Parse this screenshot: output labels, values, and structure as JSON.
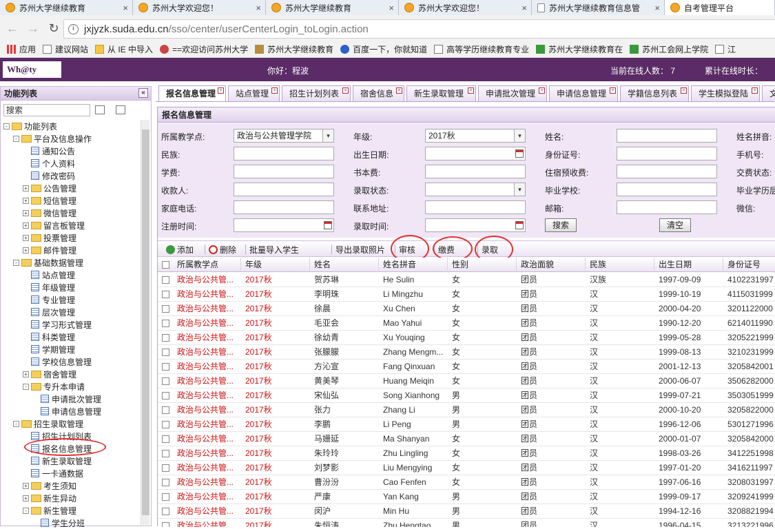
{
  "browser": {
    "tabs": [
      {
        "label": "苏州大学继续教育",
        "icon": "suda",
        "active": false
      },
      {
        "label": "苏州大学欢迎您！",
        "icon": "suda",
        "active": false
      },
      {
        "label": "苏州大学继续教育",
        "icon": "suda",
        "active": false
      },
      {
        "label": "苏州大学欢迎您！",
        "icon": "suda",
        "active": false
      },
      {
        "label": "苏州大学继续教育信息管",
        "icon": "page",
        "active": false
      },
      {
        "label": "自考管理平台",
        "icon": "suda",
        "active": true
      }
    ],
    "url_host": "jxjyzk.suda.edu.cn",
    "url_path": "/sso/center/userCenterLogin_toLogin.action",
    "bookmarks": [
      {
        "label": "应用",
        "icon": "apps"
      },
      {
        "label": "建议网站",
        "icon": "doc"
      },
      {
        "label": "从 IE 中导入",
        "icon": "folder"
      },
      {
        "label": "==欢迎访问苏州大学",
        "icon": "red"
      },
      {
        "label": "苏州大学继续教育",
        "icon": "suda"
      },
      {
        "label": "百度一下，你就知道",
        "icon": "blue"
      },
      {
        "label": "高等学历继续教育专业",
        "icon": "doc"
      },
      {
        "label": "苏州大学继续教育在",
        "icon": "green"
      },
      {
        "label": "苏州工会网上学院",
        "icon": "green"
      },
      {
        "label": "江",
        "icon": "doc"
      }
    ]
  },
  "header": {
    "logo": "Wh@ty",
    "greeting": "你好：程波",
    "online_now": "当前在线人数：  7",
    "online_total": "累计在线时长："
  },
  "left": {
    "title": "功能列表",
    "search": "搜索",
    "tree": [
      {
        "label": "功能列表",
        "level": 0,
        "kind": "folder",
        "pm": "-"
      },
      {
        "label": "平台及信息操作",
        "level": 1,
        "kind": "folder",
        "pm": "-"
      },
      {
        "label": "通知公告",
        "level": 2,
        "kind": "leaf"
      },
      {
        "label": "个人资料",
        "level": 2,
        "kind": "leaf"
      },
      {
        "label": "修改密码",
        "level": 2,
        "kind": "leaf"
      },
      {
        "label": "公告管理",
        "level": 2,
        "kind": "folder",
        "pm": "+"
      },
      {
        "label": "短信管理",
        "level": 2,
        "kind": "folder",
        "pm": "+"
      },
      {
        "label": "微信管理",
        "level": 2,
        "kind": "folder",
        "pm": "+"
      },
      {
        "label": "留言板管理",
        "level": 2,
        "kind": "folder",
        "pm": "+"
      },
      {
        "label": "投票管理",
        "level": 2,
        "kind": "folder",
        "pm": "+"
      },
      {
        "label": "邮件管理",
        "level": 2,
        "kind": "folder",
        "pm": "+"
      },
      {
        "label": "基础数据管理",
        "level": 1,
        "kind": "folder",
        "pm": "-"
      },
      {
        "label": "站点管理",
        "level": 2,
        "kind": "leaf"
      },
      {
        "label": "年级管理",
        "level": 2,
        "kind": "leaf"
      },
      {
        "label": "专业管理",
        "level": 2,
        "kind": "leaf"
      },
      {
        "label": "层次管理",
        "level": 2,
        "kind": "leaf"
      },
      {
        "label": "学习形式管理",
        "level": 2,
        "kind": "leaf"
      },
      {
        "label": "科类管理",
        "level": 2,
        "kind": "leaf"
      },
      {
        "label": "学期管理",
        "level": 2,
        "kind": "leaf"
      },
      {
        "label": "学校信息管理",
        "level": 2,
        "kind": "leaf"
      },
      {
        "label": "宿舍管理",
        "level": 2,
        "kind": "folder",
        "pm": "+"
      },
      {
        "label": "专升本申请",
        "level": 2,
        "kind": "folder",
        "pm": "-"
      },
      {
        "label": "申请批次管理",
        "level": 3,
        "kind": "leaf"
      },
      {
        "label": "申请信息管理",
        "level": 3,
        "kind": "leaf"
      },
      {
        "label": "招生录取管理",
        "level": 1,
        "kind": "folder",
        "pm": "-"
      },
      {
        "label": "招生计划列表",
        "level": 2,
        "kind": "leaf"
      },
      {
        "label": "报名信息管理",
        "level": 2,
        "kind": "leaf"
      },
      {
        "label": "新生录取管理",
        "level": 2,
        "kind": "leaf"
      },
      {
        "label": "一卡通数据",
        "level": 2,
        "kind": "leaf"
      },
      {
        "label": "考生须知",
        "level": 2,
        "kind": "folder",
        "pm": "+"
      },
      {
        "label": "新生异动",
        "level": 2,
        "kind": "folder",
        "pm": "+"
      },
      {
        "label": "新生管理",
        "level": 2,
        "kind": "folder",
        "pm": "-"
      },
      {
        "label": "学生分班",
        "level": 3,
        "kind": "leaf"
      }
    ]
  },
  "tabs": [
    {
      "label": "报名信息管理",
      "active": true
    },
    {
      "label": "站点管理",
      "active": false
    },
    {
      "label": "招生计划列表",
      "active": false
    },
    {
      "label": "宿舍信息",
      "active": false
    },
    {
      "label": "新生录取管理",
      "active": false
    },
    {
      "label": "申请批次管理",
      "active": false
    },
    {
      "label": "申请信息管理",
      "active": false
    },
    {
      "label": "学籍信息列表",
      "active": false
    },
    {
      "label": "学生模拟登陆",
      "active": false
    },
    {
      "label": "文",
      "active": false
    }
  ],
  "panel_title": "报名信息管理",
  "form": {
    "fields": [
      {
        "label": "所属教学点:",
        "value": "政治与公共管理学院",
        "type": "select"
      },
      {
        "label": "年级:",
        "value": "2017秋",
        "type": "select"
      },
      {
        "label": "姓名:",
        "value": "",
        "type": "text"
      },
      {
        "label": "姓名拼音:",
        "value": "",
        "type": "text"
      },
      {
        "label": "民族:",
        "value": "",
        "type": "text"
      },
      {
        "label": "出生日期:",
        "value": "",
        "type": "date"
      },
      {
        "label": "身份证号:",
        "value": "",
        "type": "text"
      },
      {
        "label": "手机号:",
        "value": "",
        "type": "text"
      },
      {
        "label": "学费:",
        "value": "",
        "type": "text"
      },
      {
        "label": "书本费:",
        "value": "",
        "type": "text"
      },
      {
        "label": "住宿预收费:",
        "value": "",
        "type": "text"
      },
      {
        "label": "交费状态:",
        "value": "",
        "type": "text"
      },
      {
        "label": "收款人:",
        "value": "",
        "type": "text"
      },
      {
        "label": "录取状态:",
        "value": "",
        "type": "select"
      },
      {
        "label": "毕业学校:",
        "value": "",
        "type": "text"
      },
      {
        "label": "毕业学历层",
        "value": "",
        "type": "text"
      },
      {
        "label": "家庭电话:",
        "value": "",
        "type": "text"
      },
      {
        "label": "联系地址:",
        "value": "",
        "type": "text"
      },
      {
        "label": "邮箱:",
        "value": "",
        "type": "text"
      },
      {
        "label": "微信:",
        "value": "",
        "type": "text"
      },
      {
        "label": "注册时间:",
        "value": "",
        "type": "date"
      },
      {
        "label": "录取时间:",
        "value": "",
        "type": "date"
      }
    ],
    "search_btn": "搜索",
    "clear_btn": "清空"
  },
  "toolbar": [
    {
      "label": "添加",
      "icon": "add",
      "name": "add-button"
    },
    {
      "label": "删除",
      "icon": "del",
      "name": "delete-button"
    },
    {
      "label": "批量导入学生",
      "icon": "grid",
      "name": "batch-import-button"
    },
    {
      "label": "导出录取照片",
      "icon": "grid",
      "name": "export-photos-button"
    },
    {
      "label": "审核",
      "icon": "grid",
      "name": "audit-button"
    },
    {
      "label": "缴费",
      "icon": "grid",
      "name": "payment-button"
    },
    {
      "label": "录取",
      "icon": "grid",
      "name": "admit-button"
    }
  ],
  "grid": {
    "columns": [
      "所属教学点",
      "年级",
      "姓名",
      "姓名拼音",
      "性别",
      "政治面貌",
      "民族",
      "出生日期",
      "身份证号"
    ],
    "rows": [
      [
        "政治与公共管...",
        "2017秋",
        "贺苏琳",
        "He Sulin",
        "女",
        "团员",
        "汉族",
        "1997-09-09",
        "4102231997"
      ],
      [
        "政治与公共管...",
        "2017秋",
        "李明珠",
        "Li Mingzhu",
        "女",
        "团员",
        "汉",
        "1999-10-19",
        "4115031999"
      ],
      [
        "政治与公共管...",
        "2017秋",
        "徐晨",
        "Xu Chen",
        "女",
        "团员",
        "汉",
        "2000-04-20",
        "3201122000"
      ],
      [
        "政治与公共管...",
        "2017秋",
        "毛亚会",
        "Mao Yahui",
        "女",
        "团员",
        "汉",
        "1990-12-20",
        "6214011990"
      ],
      [
        "政治与公共管...",
        "2017秋",
        "徐幼青",
        "Xu Youqing",
        "女",
        "团员",
        "汉",
        "1999-05-28",
        "3205221999"
      ],
      [
        "政治与公共管...",
        "2017秋",
        "张朦朦",
        "Zhang Mengm...",
        "女",
        "团员",
        "汉",
        "1999-08-13",
        "3210231999"
      ],
      [
        "政治与公共管...",
        "2017秋",
        "方沁宣",
        "Fang Qinxuan",
        "女",
        "团员",
        "汉",
        "2001-12-13",
        "3205842001"
      ],
      [
        "政治与公共管...",
        "2017秋",
        "黄美琴",
        "Huang Meiqin",
        "女",
        "团员",
        "汉",
        "2000-06-07",
        "3506282000"
      ],
      [
        "政治与公共管...",
        "2017秋",
        "宋仙弘",
        "Song Xianhong",
        "男",
        "团员",
        "汉",
        "1999-07-21",
        "3503051999"
      ],
      [
        "政治与公共管...",
        "2017秋",
        "张力",
        "Zhang Li",
        "男",
        "团员",
        "汉",
        "2000-10-20",
        "3205822000"
      ],
      [
        "政治与公共管...",
        "2017秋",
        "李鹏",
        "Li Peng",
        "男",
        "团员",
        "汉",
        "1996-12-06",
        "5301271996"
      ],
      [
        "政治与公共管...",
        "2017秋",
        "马姗延",
        "Ma Shanyan",
        "女",
        "团员",
        "汉",
        "2000-01-07",
        "3205842000"
      ],
      [
        "政治与公共管...",
        "2017秋",
        "朱玲玲",
        "Zhu Lingling",
        "女",
        "团员",
        "汉",
        "1998-03-26",
        "3412251998"
      ],
      [
        "政治与公共管...",
        "2017秋",
        "刘梦影",
        "Liu Mengying",
        "女",
        "团员",
        "汉",
        "1997-01-20",
        "3416211997"
      ],
      [
        "政治与公共管...",
        "2017秋",
        "曹汾汾",
        "Cao Fenfen",
        "女",
        "团员",
        "汉",
        "1997-06-16",
        "3208031997"
      ],
      [
        "政治与公共管...",
        "2017秋",
        "严康",
        "Yan Kang",
        "男",
        "团员",
        "汉",
        "1999-09-17",
        "3209241999"
      ],
      [
        "政治与公共管...",
        "2017秋",
        "闵沪",
        "Min Hu",
        "男",
        "团员",
        "汉",
        "1994-12-16",
        "3208821994"
      ],
      [
        "政治与公共管...",
        "2017秋",
        "朱恒涛",
        "Zhu Hengtao",
        "男",
        "团员",
        "汉",
        "1996-04-15",
        "3213221996"
      ]
    ]
  },
  "colors": {
    "header_bg": "#5a2b66",
    "form_bg": "#f0e6f6",
    "row_red": "#d01010",
    "annotation_red": "#e03030"
  }
}
